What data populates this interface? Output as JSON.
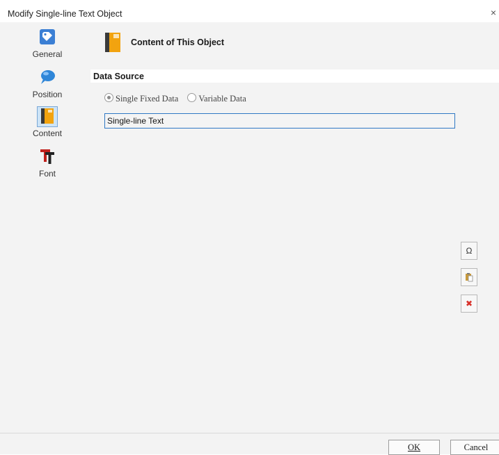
{
  "window": {
    "title": "Modify Single-line Text Object",
    "close_glyph": "×"
  },
  "sidebar": {
    "items": [
      {
        "label": "General",
        "icon": "tag-icon",
        "selected": false
      },
      {
        "label": "Position",
        "icon": "pushpin-icon",
        "selected": false
      },
      {
        "label": "Content",
        "icon": "book-icon",
        "selected": true
      },
      {
        "label": "Font",
        "icon": "font-icon",
        "selected": false
      }
    ]
  },
  "header": {
    "title": "Content of This Object",
    "icon": "book-icon"
  },
  "data_source": {
    "section_title": "Data Source",
    "options": [
      {
        "label": "Single Fixed Data",
        "checked": true
      },
      {
        "label": "Variable Data",
        "checked": false
      }
    ],
    "text_value": "Single-line Text"
  },
  "tools": [
    {
      "name": "omega-symbol",
      "glyph": "Ω"
    },
    {
      "name": "paste",
      "glyph": ""
    },
    {
      "name": "delete",
      "glyph": "✖"
    }
  ],
  "footer": {
    "ok_label": "OK",
    "cancel_label": "Cancel"
  },
  "colors": {
    "panel_bg": "#f3f3f3",
    "input_border": "#2f78c4",
    "delete_red": "#d8312a"
  }
}
